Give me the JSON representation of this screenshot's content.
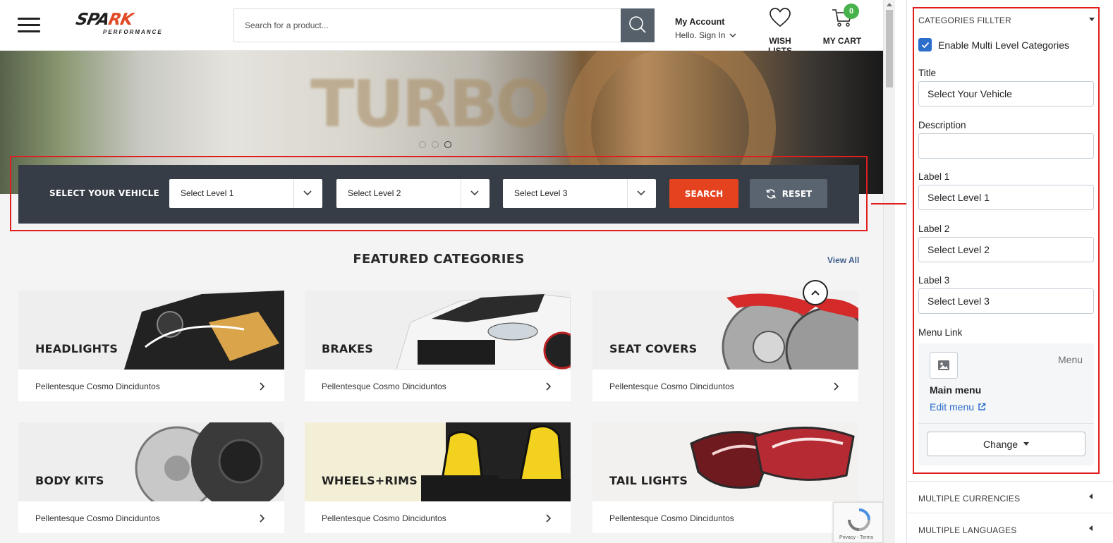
{
  "header": {
    "logo_text_a": "SPA",
    "logo_text_b": "RK",
    "logo_sub": "PERFORMANCE",
    "search_placeholder": "Search for a product...",
    "account_title": "My Account",
    "account_sub": "Hello. Sign In",
    "wish_label": "WISH LISTS",
    "cart_label": "MY CART",
    "cart_count": "0"
  },
  "hero": {
    "text": "TURBO",
    "slides": 3,
    "active_slide": 3
  },
  "vehicle": {
    "title": "SELECT YOUR VEHICLE",
    "levels": [
      "Select Level 1",
      "Select Level 2",
      "Select Level 3"
    ],
    "search_label": "SEARCH",
    "reset_label": "RESET"
  },
  "featured": {
    "title": "FEATURED CATEGORIES",
    "view_all": "View All",
    "categories": [
      {
        "name": "HEADLIGHTS",
        "desc": "Pellentesque Cosmo Dinciduntos"
      },
      {
        "name": "BRAKES",
        "desc": "Pellentesque Cosmo Dinciduntos"
      },
      {
        "name": "SEAT COVERS",
        "desc": "Pellentesque Cosmo Dinciduntos"
      },
      {
        "name": "BODY KITS",
        "desc": "Pellentesque Cosmo Dinciduntos"
      },
      {
        "name": "WHEELS+RIMS",
        "desc": "Pellentesque Cosmo Dinciduntos"
      },
      {
        "name": "TAIL LIGHTS",
        "desc": "Pellentesque Cosmo Dinciduntos"
      }
    ]
  },
  "recaptcha": {
    "text": "Privacy - Terms"
  },
  "sidebar": {
    "section_title": "CATEGORIES FILLTER",
    "enable_label": "Enable Multi Level Categories",
    "enable_checked": true,
    "fields": {
      "title_label": "Title",
      "title_value": "Select Your Vehicle",
      "description_label": "Description",
      "description_value": "",
      "label1_label": "Label 1",
      "label1_value": "Select Level 1",
      "label2_label": "Label 2",
      "label2_value": "Select Level 2",
      "label3_label": "Label 3",
      "label3_value": "Select Level 3"
    },
    "menu_link_label": "Menu Link",
    "menu": {
      "tag": "Menu",
      "name": "Main menu",
      "edit": "Edit menu",
      "change": "Change"
    },
    "collapsed_sections": [
      "MULTIPLE CURRENCIES",
      "MULTIPLE LANGUAGES"
    ]
  },
  "colors": {
    "accent": "#e5431f",
    "bar_bg": "#363d46",
    "highlight": "#e01e1e",
    "link": "#2c6ecb",
    "badge": "#48b24a"
  }
}
